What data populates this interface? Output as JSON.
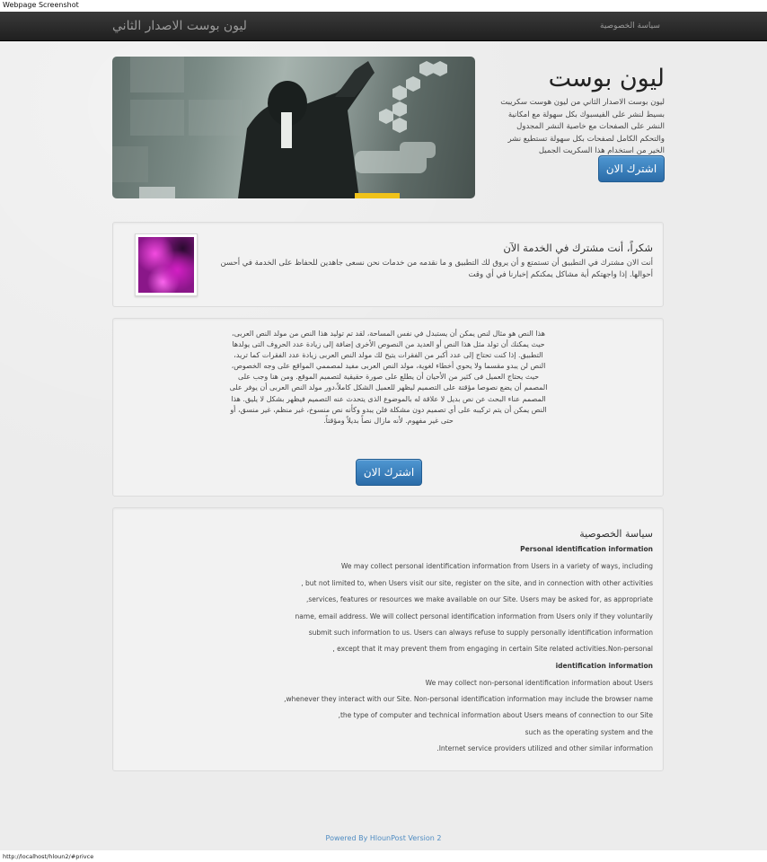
{
  "capture_title": "Webpage Screenshot",
  "navbar": {
    "brand": "ليون بوست الاصدار الثاني",
    "privacy_link": "سياسة الخصوصية"
  },
  "hero": {
    "title": "ليون بوست",
    "description": "ليون بوست الاصدار الثاني من ليون هوست سكريبت بسيط لنشر على الفيسبوك بكل سهولة مع امكانية النشر على الصفحات مع خاصية النشر المجدول والتحكم الكامل لصفحات بكل سهولة تستطيع نشر الخير من استخدام هذا السكريت الجميل",
    "subscribe_button": "اشترك الان"
  },
  "subscribed": {
    "title": "شكراً، أنت مشترك في الخدمة الآن",
    "text": "أنت الان مشترك في التطبيق أن تستمتع و أن يروق لك التطبيق و ما نقدمه من خدمات نحن نسعى جاهدين للحفاظ على الخدمة في أحسن أحوالها. إذا واجهتكم أية مشاكل يمكنكم إخبارنا في أي وقت"
  },
  "sample_text": {
    "text": "هذا النص هو مثال لنص يمكن أن يستبدل في نفس المساحة، لقد تم توليد هذا النص من مولد النص العربى، حيث يمكنك أن تولد مثل هذا النص أو العديد من النصوص الأخرى إضافة إلى زيادة عدد الحروف التى يولدها التطبيق. إذا كنت تحتاج إلى عدد أكبر من الفقرات يتيح لك مولد النص العربى زيادة عدد الفقرات كما تريد، النص لن يبدو مقسما ولا يحوي أخطاء لغوية، مولد النص العربى مفيد لمصممي المواقع على وجه الخصوص، حيث يحتاج العميل فى كثير من الأحيان أن يطلع على صورة حقيقية لتصميم الموقع. ومن هنا وجب على المصمم أن يضع نصوصا مؤقتة على التصميم ليظهر للعميل الشكل كاملاً،دور مولد النص العربى أن يوفر على المصمم عناء البحث عن نص بديل لا علاقة له بالموضوع الذى يتحدث عنه التصميم فيظهر بشكل لا يليق. هذا النص يمكن أن يتم تركيبه على أي تصميم دون مشكلة فلن يبدو وكأنه نص منسوخ، غير منظم، غير منسق، أو حتى غير مفهوم. لأنه مازال نصاً بديلاً ومؤقتاً.",
    "subscribe_button": "اشترك الان"
  },
  "privacy": {
    "title": "سياسة الخصوصية",
    "lines": [
      "Personal identification information",
      "We may collect personal identification information from Users in a variety of ways, including",
      "but not limited to, when Users visit our site, register on the site, and in connection with other activities ,",
      "services, features or resources we make available on our Site. Users may be asked for, as appropriate,",
      "name, email address. We will collect personal identification information from Users only if they voluntarily",
      "submit such information to us. Users can always refuse to supply personally identification information",
      "except that it may prevent them from engaging in certain Site related activities.Non-personal ,",
      "identification information",
      "We may collect non-personal identification information about Users",
      "whenever they interact with our Site. Non-personal identification information may include the browser name,",
      "the type of computer and technical information about Users means of connection to our Site,",
      "such as the operating system and the",
      "Internet service providers utilized and other similar information."
    ]
  },
  "footer": {
    "text": "Powered By HlounPost Version 2"
  },
  "status_url": "http://localhost/hloun2/#privce"
}
